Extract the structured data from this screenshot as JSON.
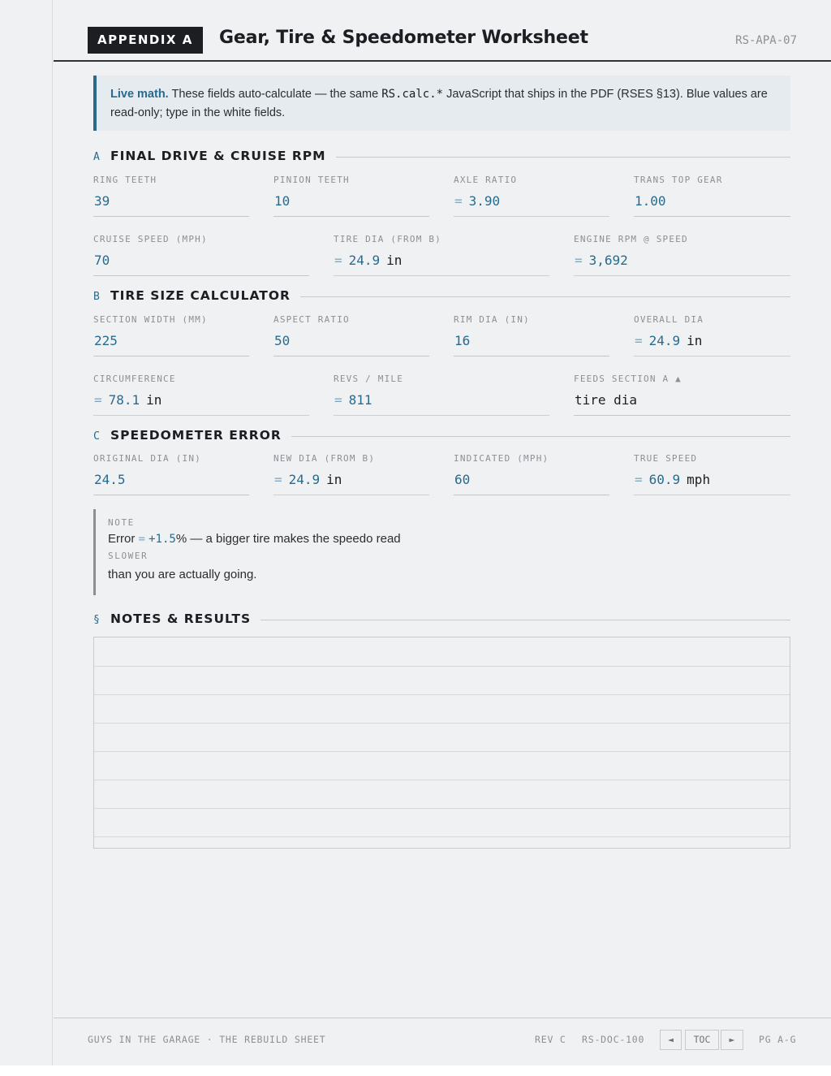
{
  "header": {
    "tag": "APPENDIX A",
    "title": "Gear, Tire & Speedometer Worksheet",
    "code": "RS-APA-07"
  },
  "callout": {
    "lead": "Live math.",
    "text_before": " These fields auto-calculate — the same ",
    "code": "RS.calc.*",
    "text_after": " JavaScript that ships in the PDF (RSES §13). Blue values are read-only; type in the white fields."
  },
  "sections": {
    "a": {
      "letter": "A",
      "name": "FINAL DRIVE & CRUISE RPM",
      "ring_teeth": {
        "label": "RING TEETH",
        "value": "39"
      },
      "pinion_teeth": {
        "label": "PINION TEETH",
        "value": "10"
      },
      "axle_ratio": {
        "label": "AXLE RATIO",
        "eq": "=",
        "value": "3.90"
      },
      "trans_top_gear": {
        "label": "TRANS TOP GEAR",
        "value": "1.00"
      },
      "cruise_speed": {
        "label": "CRUISE SPEED (MPH)",
        "value": "70"
      },
      "tire_dia": {
        "label": "TIRE DIA (FROM B)",
        "eq": "=",
        "value": "24.9",
        "unit": "in"
      },
      "engine_rpm": {
        "label": "ENGINE RPM @ SPEED",
        "eq": "=",
        "value": "3,692"
      }
    },
    "b": {
      "letter": "B",
      "name": "TIRE SIZE CALCULATOR",
      "section_width": {
        "label": "SECTION WIDTH (MM)",
        "value": "225"
      },
      "aspect_ratio": {
        "label": "ASPECT RATIO",
        "value": "50"
      },
      "rim_dia": {
        "label": "RIM DIA (IN)",
        "value": "16"
      },
      "overall_dia": {
        "label": "OVERALL DIA",
        "eq": "=",
        "value": "24.9",
        "unit": "in"
      },
      "circumference": {
        "label": "CIRCUMFERENCE",
        "eq": "=",
        "value": "78.1",
        "unit": "in"
      },
      "revs_per_mile": {
        "label": "REVS / MILE",
        "eq": "=",
        "value": "811"
      },
      "feeds": {
        "label": "FEEDS SECTION A ▲",
        "value": "tire dia"
      }
    },
    "c": {
      "letter": "C",
      "name": "SPEEDOMETER ERROR",
      "original_dia": {
        "label": "ORIGINAL DIA (IN)",
        "value": "24.5"
      },
      "new_dia": {
        "label": "NEW DIA (FROM B)",
        "eq": "=",
        "value": "24.9",
        "unit": "in"
      },
      "indicated": {
        "label": "INDICATED (MPH)",
        "value": "60"
      },
      "true_speed": {
        "label": "TRUE SPEED",
        "eq": "=",
        "value": "60.9",
        "unit": "mph"
      }
    },
    "notes": {
      "letter": "§",
      "name": "NOTES & RESULTS"
    }
  },
  "note": {
    "label": "NOTE",
    "prefix": "Error ",
    "eq": "=",
    "pct": "+1.5",
    "suffix": "% — a bigger tire makes the speedo read",
    "emphasis": "SLOWER",
    "line2": "than you are actually going."
  },
  "footer": {
    "left": "GUYS IN THE GARAGE · THE REBUILD SHEET",
    "rev": "REV C",
    "doc": "RS-DOC-100",
    "prev": "◄",
    "toc": "TOC",
    "next": "►",
    "page": "PG A-G"
  }
}
